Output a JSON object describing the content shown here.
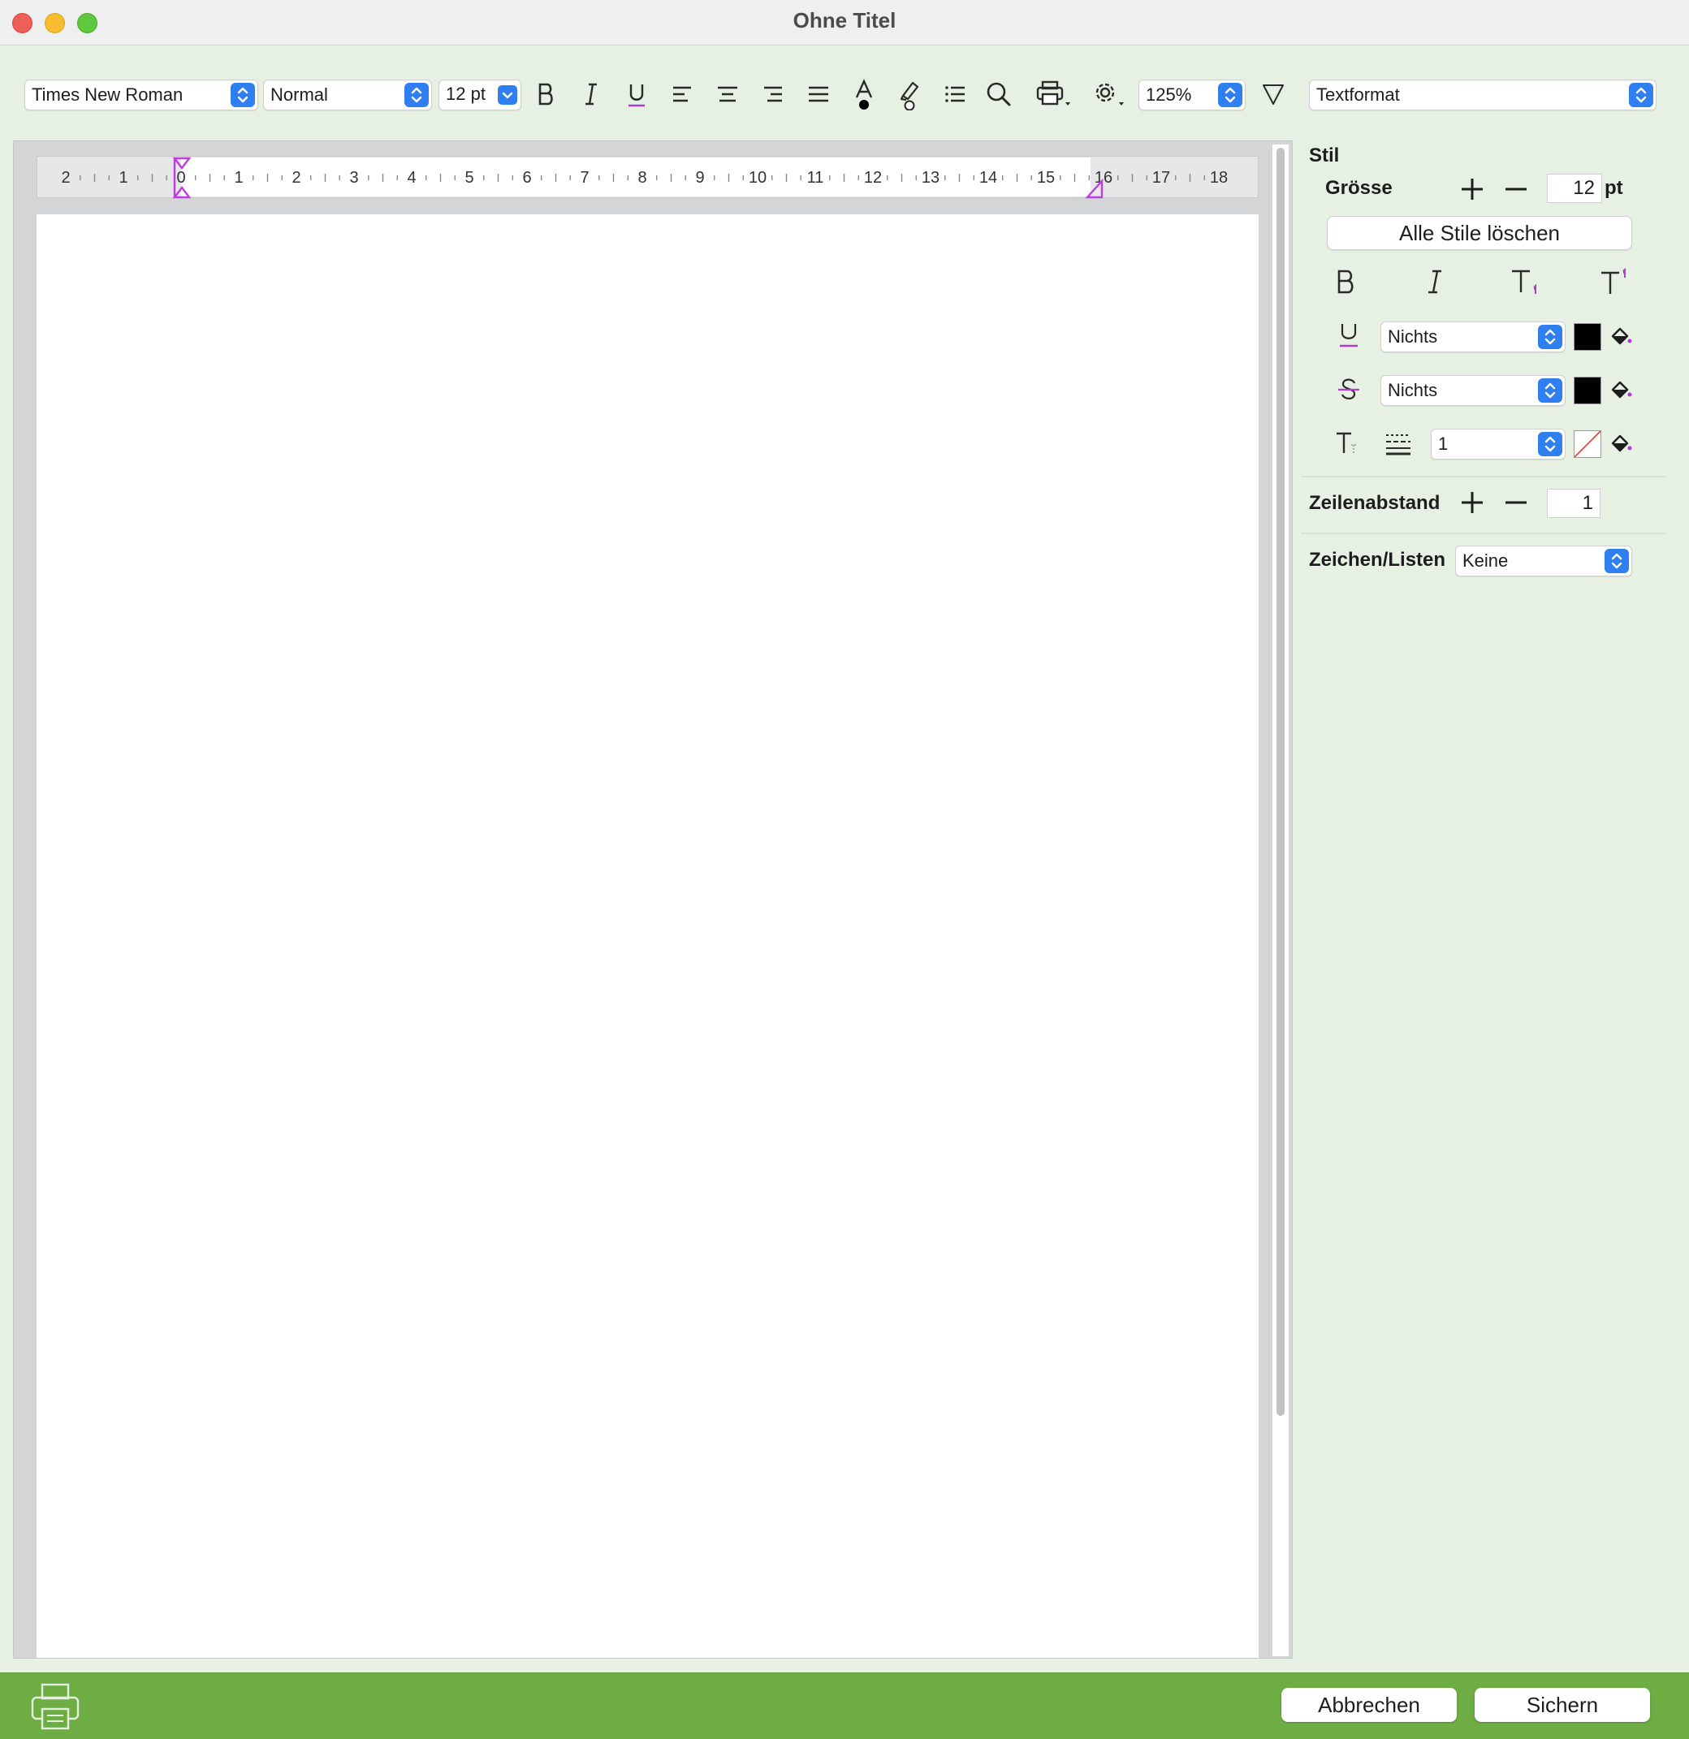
{
  "window": {
    "title": "Ohne Titel"
  },
  "toolbar": {
    "font_family": "Times New Roman",
    "paragraph_style": "Normal",
    "font_size": "12 pt",
    "zoom": "125%",
    "icons": [
      "bold-icon",
      "italic-icon",
      "underline-icon",
      "align-left-icon",
      "align-center-icon",
      "align-right-icon",
      "justify-icon",
      "text-color-icon",
      "highlight-icon",
      "list-icon",
      "search-icon",
      "print-icon",
      "gear-icon",
      "filter-icon"
    ]
  },
  "ruler": {
    "ticks": [
      "2",
      "1",
      "0",
      "1",
      "2",
      "3",
      "4",
      "5",
      "6",
      "7",
      "8",
      "9",
      "10",
      "11",
      "12",
      "13",
      "14",
      "15",
      "16",
      "17",
      "18"
    ],
    "marker_color": "#c23be0"
  },
  "panel": {
    "mode": "Textformat",
    "style_header": "Stil",
    "size_label": "Grösse",
    "size_value": "12",
    "size_unit": "pt",
    "clear_styles": "Alle Stile löschen",
    "underline_value": "Nichts",
    "strikethrough_value": "Nichts",
    "baseline_value": "1",
    "underline_color": "#000000",
    "strikethrough_color": "#000000",
    "line_spacing_label": "Zeilenabstand",
    "line_spacing_value": "1",
    "lists_label": "Zeichen/Listen",
    "lists_value": "Keine"
  },
  "bottom": {
    "cancel": "Abbrechen",
    "save": "Sichern"
  },
  "colors": {
    "accent": "#2f7ff0",
    "panel_bg": "#e7f1e3",
    "bottom_bar": "#6ead44"
  }
}
